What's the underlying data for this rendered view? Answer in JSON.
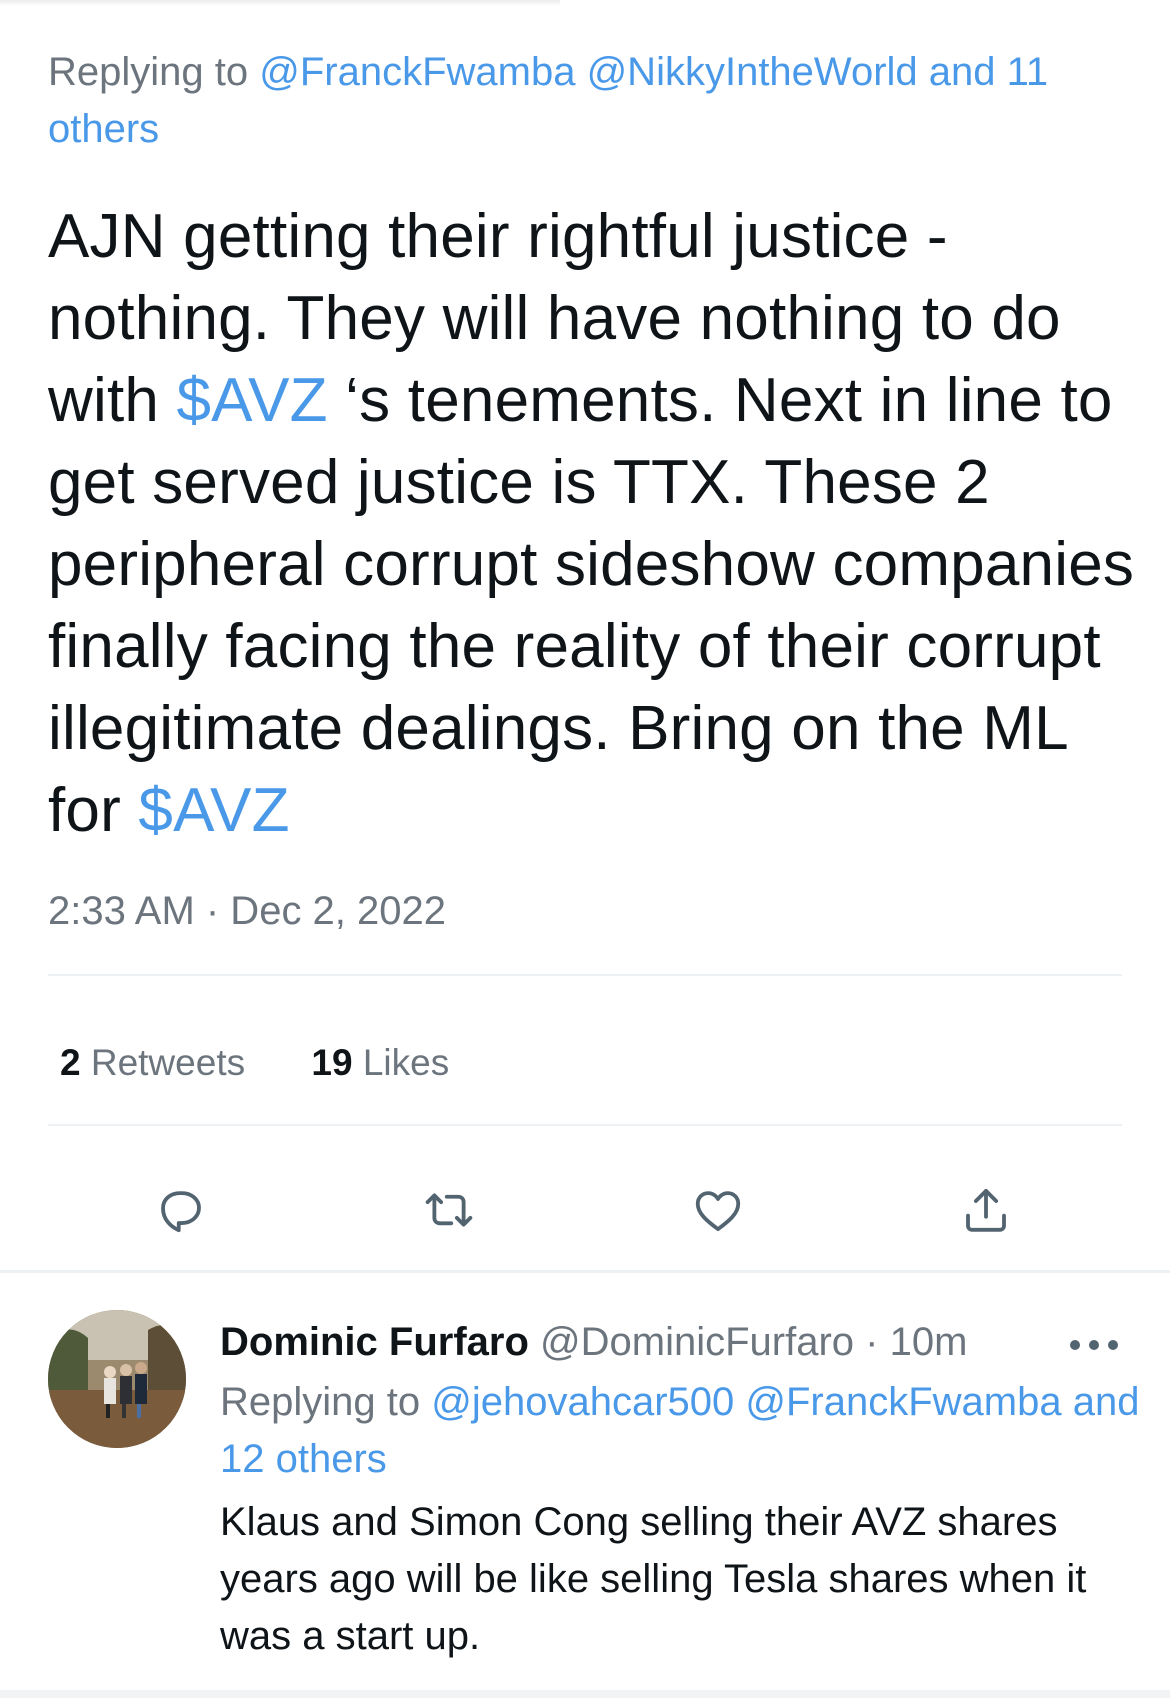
{
  "tweet": {
    "replying_prefix": "Replying to ",
    "replying_mentions": "@FranckFwamba @NikkyIntheWorld and 11 others",
    "body_part1": "AJN getting their rightful justice - nothing. They will have nothing to do with ",
    "cashtag1": "$AVZ",
    "body_part2": " ‘s tenements. Next in line to get served justice is TTX. These 2 peripheral corrupt sideshow companies finally facing the reality of their corrupt illegitimate dealings. Bring on the ML for ",
    "cashtag2": "$AVZ",
    "timestamp": "2:33 AM · Dec 2, 2022",
    "retweets_count": "2",
    "retweets_label": "Retweets",
    "likes_count": "19",
    "likes_label": "Likes",
    "actions": {
      "reply_icon": "comment-bubble-icon",
      "retweet_icon": "retweet-arrows-icon",
      "like_icon": "heart-icon",
      "share_icon": "share-upload-icon"
    }
  },
  "reply": {
    "name": "Dominic Furfaro",
    "handle_time": " @DominicFurfaro · 10m",
    "replying_prefix": "Replying to ",
    "replying_mentions": "@jehovahcar500 @FranckFwamba and 12 others",
    "body": "Klaus and Simon Cong selling their AVZ shares years ago will be like selling Tesla shares when it was a start up.",
    "more_icon": "more-horizontal-icon"
  },
  "colors": {
    "link": "#4a99e9",
    "text": "#0f1419",
    "secondary": "#6c757d",
    "divider": "#eef1f3"
  }
}
